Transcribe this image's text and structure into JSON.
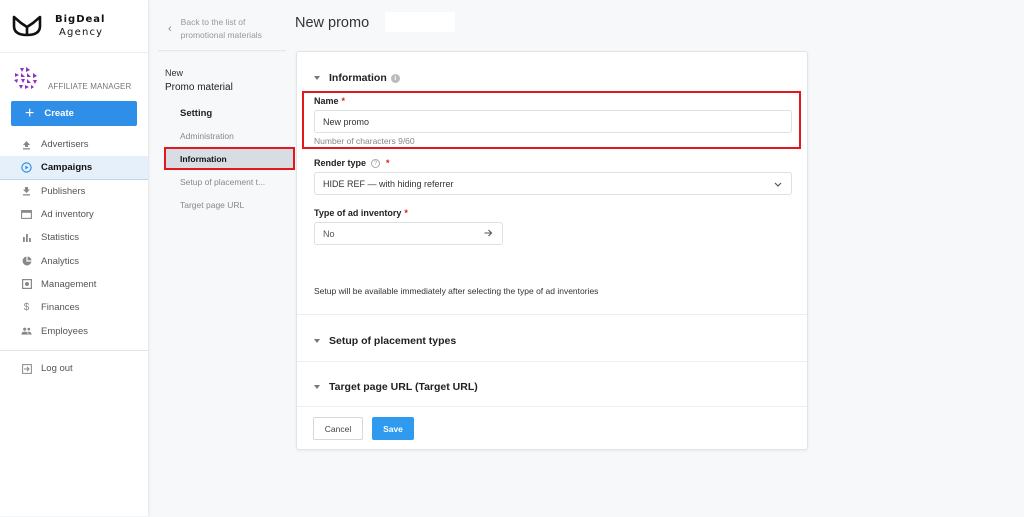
{
  "brand": {
    "name_line1": "BigDeal",
    "name_line2": "Agency"
  },
  "user": {
    "role": "AFFILIATE MANAGER"
  },
  "sidebar": {
    "create_label": "Create",
    "items": [
      {
        "label": "Advertisers",
        "icon": "upload-icon"
      },
      {
        "label": "Campaigns",
        "icon": "play-circle-icon",
        "active": true
      },
      {
        "label": "Publishers",
        "icon": "download-icon"
      },
      {
        "label": "Ad inventory",
        "icon": "window-icon"
      },
      {
        "label": "Statistics",
        "icon": "bar-chart-icon"
      },
      {
        "label": "Analytics",
        "icon": "pie-chart-icon"
      },
      {
        "label": "Management",
        "icon": "settings-box-icon"
      },
      {
        "label": "Finances",
        "icon": "dollar-icon"
      },
      {
        "label": "Employees",
        "icon": "people-icon"
      }
    ],
    "logout_label": "Log out"
  },
  "promo_nav": {
    "back_line1": "Back to the list of",
    "back_line2": "promotional materials",
    "new_label": "New",
    "title": "Promo material",
    "items": [
      {
        "label": "Setting",
        "type": "head"
      },
      {
        "label": "Administration"
      },
      {
        "label": "Information",
        "active": true
      },
      {
        "label": "Setup of placement t..."
      },
      {
        "label": "Target page URL"
      }
    ]
  },
  "page": {
    "title": "New promo"
  },
  "form": {
    "information": {
      "heading": "Information",
      "name_label": "Name",
      "name_value": "New promo",
      "name_hint": "Number of characters 9/60",
      "render_label": "Render type",
      "render_value": "HIDE REF — with hiding referrer",
      "inventory_label": "Type of ad inventory",
      "inventory_value": "No",
      "setup_note": "Setup will be available immediately after selecting the type of ad inventories"
    },
    "placement_heading": "Setup of placement types",
    "target_heading": "Target page URL (Target URL)",
    "cancel_label": "Cancel",
    "save_label": "Save",
    "required_mark": "*"
  },
  "colors": {
    "accent": "#2f8fe8",
    "highlight": "#e0191e",
    "avatar": "#8e2fc0"
  }
}
